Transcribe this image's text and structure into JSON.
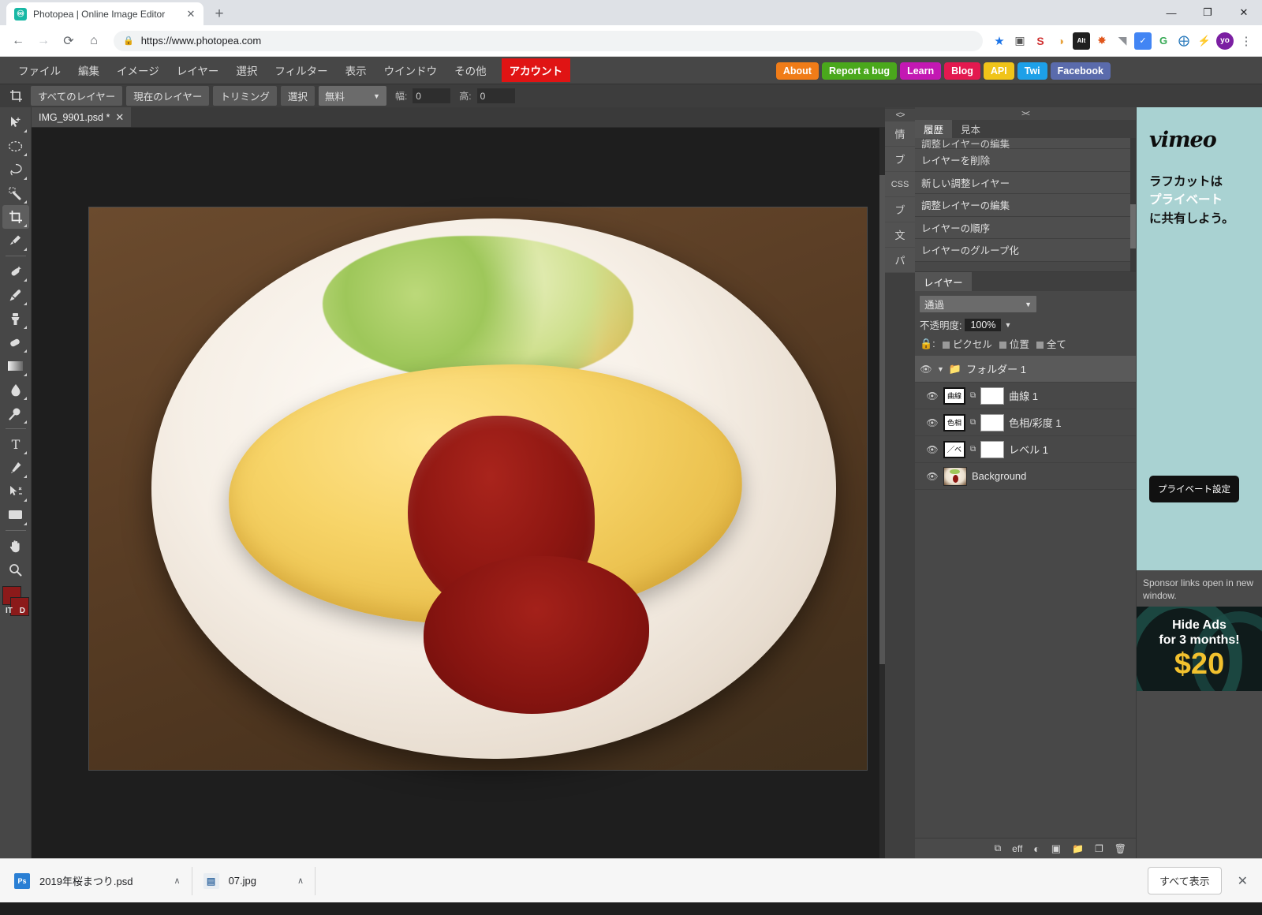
{
  "browser": {
    "tab": {
      "title": "Photopea | Online Image Editor",
      "favicon": "photopea-icon",
      "close": "✕"
    },
    "newtab": "+",
    "window": {
      "minimize": "—",
      "restore": "❐",
      "close": "✕"
    },
    "nav": {
      "back": "←",
      "forward": "→",
      "reload": "⟳",
      "home": "⌂"
    },
    "omnibox": {
      "lock": "🔒",
      "url": "https://www.photopea.com"
    },
    "extensions": [
      {
        "name": "bookmark-star-icon",
        "glyph": "★",
        "color": "#1a73e8"
      },
      {
        "name": "screenshot-camera-icon",
        "glyph": "▣",
        "color": "#4a4a4a"
      },
      {
        "name": "seo-extension-icon",
        "glyph": "S",
        "color": "#d03131"
      },
      {
        "name": "droplet-extension-icon",
        "glyph": "◕",
        "color": "#e8a33d"
      },
      {
        "name": "alt-text-extension-icon",
        "glyph": "Alt",
        "color": "#1f1f1f"
      },
      {
        "name": "color-wheel-extension-icon",
        "glyph": "✸",
        "color": "#e0561c"
      },
      {
        "name": "gray-shape-extension-icon",
        "glyph": "◥",
        "color": "#8e9196"
      },
      {
        "name": "checkmark-extension-icon",
        "glyph": "✓",
        "color": "#4285f4"
      },
      {
        "name": "google-extension-icon",
        "glyph": "G",
        "color": "#34a853"
      },
      {
        "name": "blue-circle-extension-icon",
        "glyph": "⊕",
        "color": "#1d72b8"
      },
      {
        "name": "lightning-extension-icon",
        "glyph": "⚡",
        "color": "#2a2a2a"
      }
    ],
    "profile_avatar": "yo",
    "menu": "⋮"
  },
  "photopea": {
    "menubar": [
      {
        "label": "ファイル",
        "name": "menu-file"
      },
      {
        "label": "編集",
        "name": "menu-edit"
      },
      {
        "label": "イメージ",
        "name": "menu-image"
      },
      {
        "label": "レイヤー",
        "name": "menu-layer"
      },
      {
        "label": "選択",
        "name": "menu-select"
      },
      {
        "label": "フィルター",
        "name": "menu-filter"
      },
      {
        "label": "表示",
        "name": "menu-view"
      },
      {
        "label": "ウインドウ",
        "name": "menu-window"
      },
      {
        "label": "その他",
        "name": "menu-more"
      }
    ],
    "account_label": "アカウント",
    "links": [
      {
        "label": "About",
        "color": "#f07c18"
      },
      {
        "label": "Report a bug",
        "color": "#4aa81c"
      },
      {
        "label": "Learn",
        "color": "#c318b3"
      },
      {
        "label": "Blog",
        "color": "#e3194f"
      },
      {
        "label": "API",
        "color": "#f0c419"
      },
      {
        "label": "Twi",
        "color": "#1da0e8"
      },
      {
        "label": "Facebook",
        "color": "#5a6bac"
      }
    ],
    "options_bar": {
      "tool_icon": "crop-icon",
      "all_layers": "すべてのレイヤー",
      "current_layer": "現在のレイヤー",
      "trim": "トリミング",
      "select": "選択",
      "ratio_value": "無料",
      "ratio_caret": "▼",
      "width_label": "幅:",
      "width_value": "0",
      "height_label": "高:",
      "height_value": "0"
    },
    "tools": [
      {
        "name": "move-tool",
        "glyph": "➤",
        "active": false
      },
      {
        "name": "marquee-tool",
        "glyph": "◯",
        "active": false
      },
      {
        "name": "lasso-tool",
        "glyph": "❂",
        "active": false
      },
      {
        "name": "magic-wand-tool",
        "glyph": "✦",
        "active": false
      },
      {
        "name": "crop-tool",
        "glyph": "⌗",
        "active": true
      },
      {
        "name": "eyedropper-tool",
        "glyph": "✒",
        "active": false
      },
      {
        "name": "healing-brush-tool",
        "glyph": "✙",
        "active": false
      },
      {
        "name": "paintbrush-tool",
        "glyph": "✎",
        "active": false
      },
      {
        "name": "clone-stamp-tool",
        "glyph": "⚓",
        "active": false
      },
      {
        "name": "eraser-tool",
        "glyph": "◭",
        "active": false
      },
      {
        "name": "gradient-tool",
        "glyph": "▤",
        "active": false
      },
      {
        "name": "blur-tool",
        "glyph": "●",
        "active": false
      },
      {
        "name": "dodge-tool",
        "glyph": "⚲",
        "active": false
      },
      {
        "name": "text-tool",
        "glyph": "T",
        "active": false
      },
      {
        "name": "pen-tool",
        "glyph": "✐",
        "active": false
      },
      {
        "name": "path-select-tool",
        "glyph": "➤",
        "active": false
      },
      {
        "name": "shape-tool",
        "glyph": "▬",
        "active": false
      },
      {
        "name": "hand-tool",
        "glyph": "✋",
        "active": false
      },
      {
        "name": "zoom-tool",
        "glyph": "⚲",
        "active": false
      }
    ],
    "color_swatches": {
      "foreground": "#8b1a1a",
      "background": "#8b1a1a",
      "fg_letter": "IT",
      "bg_letter": "D"
    },
    "document_tab": {
      "name": "IMG_9901.psd *",
      "close": "✕"
    },
    "side_tabs": [
      {
        "label": "情",
        "name": "tab-info"
      },
      {
        "label": "ブ",
        "name": "tab-brushes"
      },
      {
        "label": "CSS",
        "name": "tab-css"
      },
      {
        "label": "ブ",
        "name": "tab-blend"
      },
      {
        "label": "文",
        "name": "tab-character"
      },
      {
        "label": "パ",
        "name": "tab-paragraph"
      }
    ],
    "side_tabs_header": "<>",
    "panel_grip": "><",
    "history_panel": {
      "tabs": [
        {
          "label": "履歴",
          "active": true
        },
        {
          "label": "見本",
          "active": false
        }
      ],
      "items": [
        {
          "label": "調整レイヤーの編集",
          "clipped": true
        },
        {
          "label": "レイヤーを削除",
          "clipped": false
        },
        {
          "label": "新しい調整レイヤー",
          "clipped": false
        },
        {
          "label": "調整レイヤーの編集",
          "clipped": false
        },
        {
          "label": "レイヤーの順序",
          "clipped": false
        },
        {
          "label": "レイヤーのグループ化",
          "clipped": false
        }
      ]
    },
    "layers_panel": {
      "tab_label": "レイヤー",
      "blend_mode": "通過",
      "blend_caret": "▼",
      "opacity_label": "不透明度:",
      "opacity_value": "100%",
      "opacity_caret": "▼",
      "lock_label": "🔒:",
      "lock_options": [
        {
          "label": "ピクセル"
        },
        {
          "label": "位置"
        },
        {
          "label": "全て"
        }
      ],
      "layers": [
        {
          "type": "group",
          "name": "フォルダー 1",
          "eye": "👁",
          "arrow": "▼",
          "folder": "📁"
        },
        {
          "type": "adjustment",
          "name": "曲線 1",
          "eye": "👁",
          "thumb_text": "曲線",
          "link": "⧉"
        },
        {
          "type": "adjustment",
          "name": "色相/彩度 1",
          "eye": "👁",
          "thumb_text": "色相",
          "link": "⧉"
        },
        {
          "type": "adjustment",
          "name": "レベル 1",
          "eye": "👁",
          "thumb_text": "╱ベ",
          "link": "⧉"
        },
        {
          "type": "image",
          "name": "Background",
          "eye": "👁",
          "thumb_text": "",
          "link": ""
        }
      ],
      "footer_buttons": [
        {
          "name": "link-layers-button",
          "glyph": "⧉"
        },
        {
          "name": "layer-effects-button",
          "glyph": "eff"
        },
        {
          "name": "adjustment-layer-button",
          "glyph": "◐"
        },
        {
          "name": "layer-mask-button",
          "glyph": "▣"
        },
        {
          "name": "new-group-button",
          "glyph": "📁"
        },
        {
          "name": "new-layer-button",
          "glyph": "❐"
        },
        {
          "name": "delete-layer-button",
          "glyph": "🗑"
        }
      ]
    },
    "ads": {
      "info_icon": "ⓘ",
      "vimeo": {
        "logo": "vimeo",
        "line1": "ラフカットは",
        "line2": "プライベート",
        "line3": "に共有しよう。",
        "button": "プライベート設定"
      },
      "note": "Sponsor links open in new window.",
      "hide_ads": {
        "line1": "Hide Ads",
        "line2": "for 3 months!",
        "price": "$20"
      }
    }
  },
  "download_bar": {
    "items": [
      {
        "name": "2019年桜まつり.psd",
        "icon": "Ps",
        "caret": "∧"
      },
      {
        "name": "07.jpg",
        "icon": "▤",
        "caret": "∧"
      }
    ],
    "show_all": "すべて表示",
    "close": "✕"
  }
}
